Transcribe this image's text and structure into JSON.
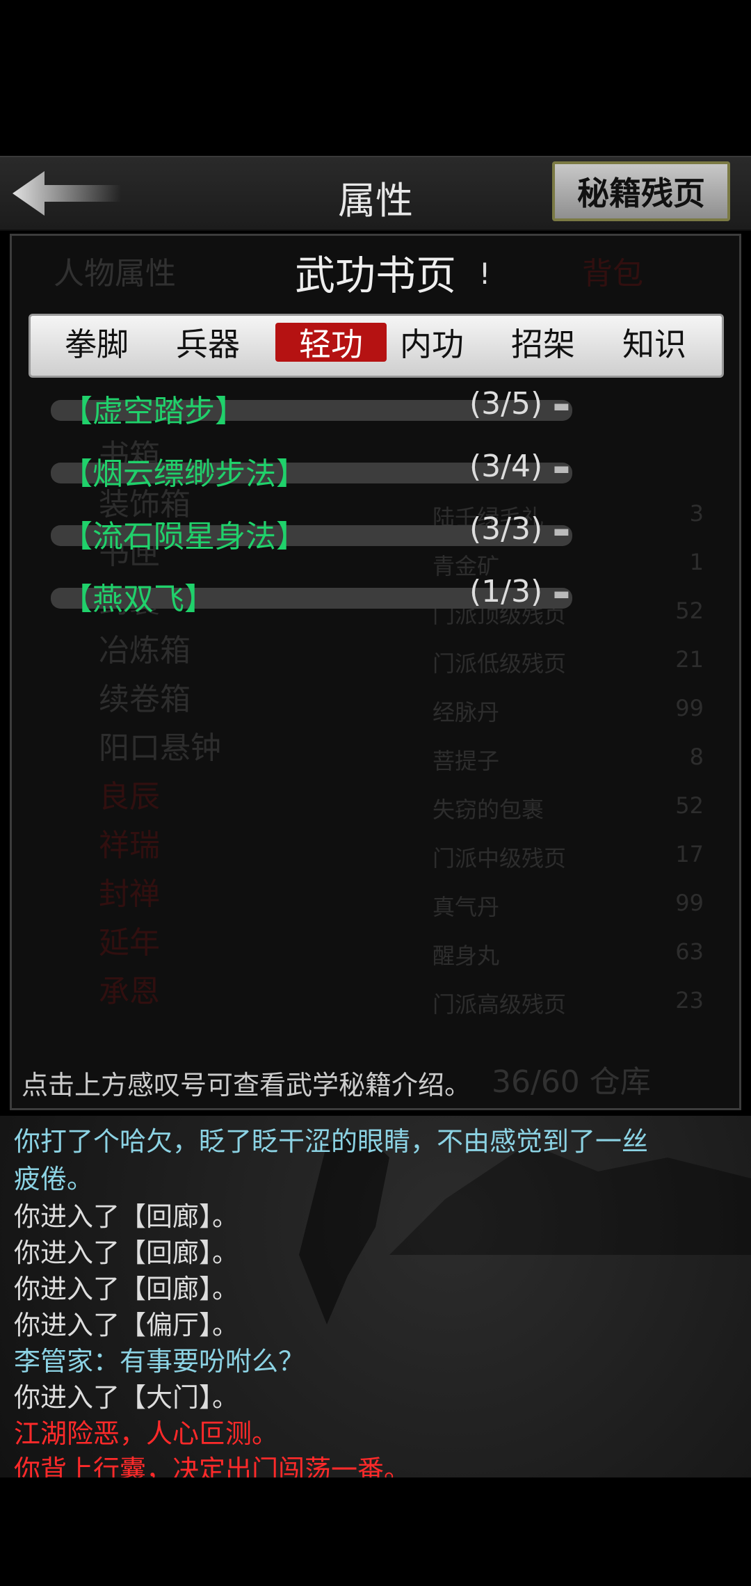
{
  "header": {
    "title": "属性",
    "secret_button": "秘籍残页"
  },
  "background_panel": {
    "tabs": [
      "人物属性",
      "背包"
    ],
    "list": [
      "书箱",
      "装饰箱",
      "书匣",
      "药囊",
      "冶炼箱",
      "续卷箱",
      "阳口悬钟",
      "良辰",
      "祥瑞",
      "封禅",
      "延年",
      "承恩"
    ],
    "grid": [
      {
        "name": "陆壬绿毛礼",
        "num": "3"
      },
      {
        "name": "青金矿",
        "num": "1"
      },
      {
        "name": "门派顶级残页",
        "num": "52"
      },
      {
        "name": "门派低级残页",
        "num": "21"
      },
      {
        "name": "经脉丹",
        "num": "99"
      },
      {
        "name": "菩提子",
        "num": "8"
      },
      {
        "name": "失窃的包裹",
        "num": "52"
      },
      {
        "name": "门派中级残页",
        "num": "17"
      },
      {
        "name": "真气丹",
        "num": "99"
      },
      {
        "name": "醒身丸",
        "num": "63"
      },
      {
        "name": "门派高级残页",
        "num": "23"
      }
    ],
    "capacity": "36/60 仓库"
  },
  "dialog": {
    "title": "武功书页",
    "info_symbol": "!",
    "tabs": [
      {
        "label": "拳脚",
        "active": false
      },
      {
        "label": "兵器",
        "active": false
      },
      {
        "label": "轻功",
        "active": true
      },
      {
        "label": "内功",
        "active": false
      },
      {
        "label": "招架",
        "active": false
      },
      {
        "label": "知识",
        "active": false
      }
    ],
    "skills": [
      {
        "name": "【虚空踏步】",
        "count": "(3/5)"
      },
      {
        "name": "【烟云缥缈步法】",
        "count": "(3/4)"
      },
      {
        "name": "【流石陨星身法】",
        "count": "(3/3)"
      },
      {
        "name": "【燕双飞】",
        "count": "(1/3)"
      }
    ],
    "hint": "点击上方感叹号可查看武学秘籍介绍。"
  },
  "log": {
    "lines": [
      {
        "text": "你打了个哈欠，眨了眨干涩的眼睛，不由感觉到了一丝",
        "color": "#8cd3e4"
      },
      {
        "text": "疲倦。",
        "color": "#8cd3e4"
      },
      {
        "text": "你进入了【回廊】。",
        "color": "#dddddd"
      },
      {
        "text": "你进入了【回廊】。",
        "color": "#dddddd"
      },
      {
        "text": "你进入了【回廊】。",
        "color": "#dddddd"
      },
      {
        "text": "你进入了【偏厅】。",
        "color": "#dddddd"
      },
      {
        "text": "李管家：有事要吩咐么？",
        "color": "#8cd3e4"
      },
      {
        "text": "你进入了【大门】。",
        "color": "#dddddd"
      },
      {
        "text": "江湖险恶，人心叵测。",
        "color": "#ff2a2a"
      },
      {
        "text": "你背上行囊，决定出门闯荡一番。",
        "color": "#ff2a2a"
      }
    ]
  }
}
